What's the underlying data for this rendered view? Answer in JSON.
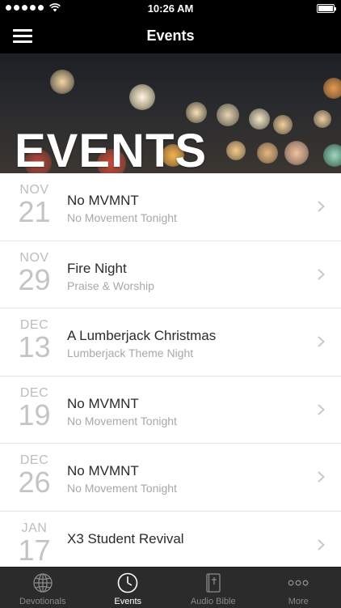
{
  "status_bar": {
    "time": "10:26 AM"
  },
  "nav": {
    "title": "Events"
  },
  "hero": {
    "title": "EVENTS"
  },
  "events": [
    {
      "month": "NOV",
      "day": "21",
      "name": "No MVMNT",
      "subtitle": "No Movement Tonight"
    },
    {
      "month": "NOV",
      "day": "29",
      "name": "Fire Night",
      "subtitle": "Praise & Worship"
    },
    {
      "month": "DEC",
      "day": "13",
      "name": "A Lumberjack Christmas",
      "subtitle": "Lumberjack Theme Night"
    },
    {
      "month": "DEC",
      "day": "19",
      "name": "No MVMNT",
      "subtitle": "No Movement Tonight"
    },
    {
      "month": "DEC",
      "day": "26",
      "name": "No MVMNT",
      "subtitle": "No Movement Tonight"
    },
    {
      "month": "JAN",
      "day": "17",
      "name": "X3 Student Revival",
      "subtitle": ""
    }
  ],
  "tabs": [
    {
      "label": "Devotionals",
      "icon": "globe-icon",
      "active": false
    },
    {
      "label": "Events",
      "icon": "clock-icon",
      "active": true
    },
    {
      "label": "Audio Bible",
      "icon": "bible-icon",
      "active": false
    },
    {
      "label": "More",
      "icon": "more-dots-icon",
      "active": false
    }
  ],
  "colors": {
    "bar_background": "#000000",
    "tab_background": "#2b2b2b",
    "active_tab": "#ffffff",
    "inactive_tab": "#8a8a8a",
    "date_gray": "#bdbdbd"
  }
}
